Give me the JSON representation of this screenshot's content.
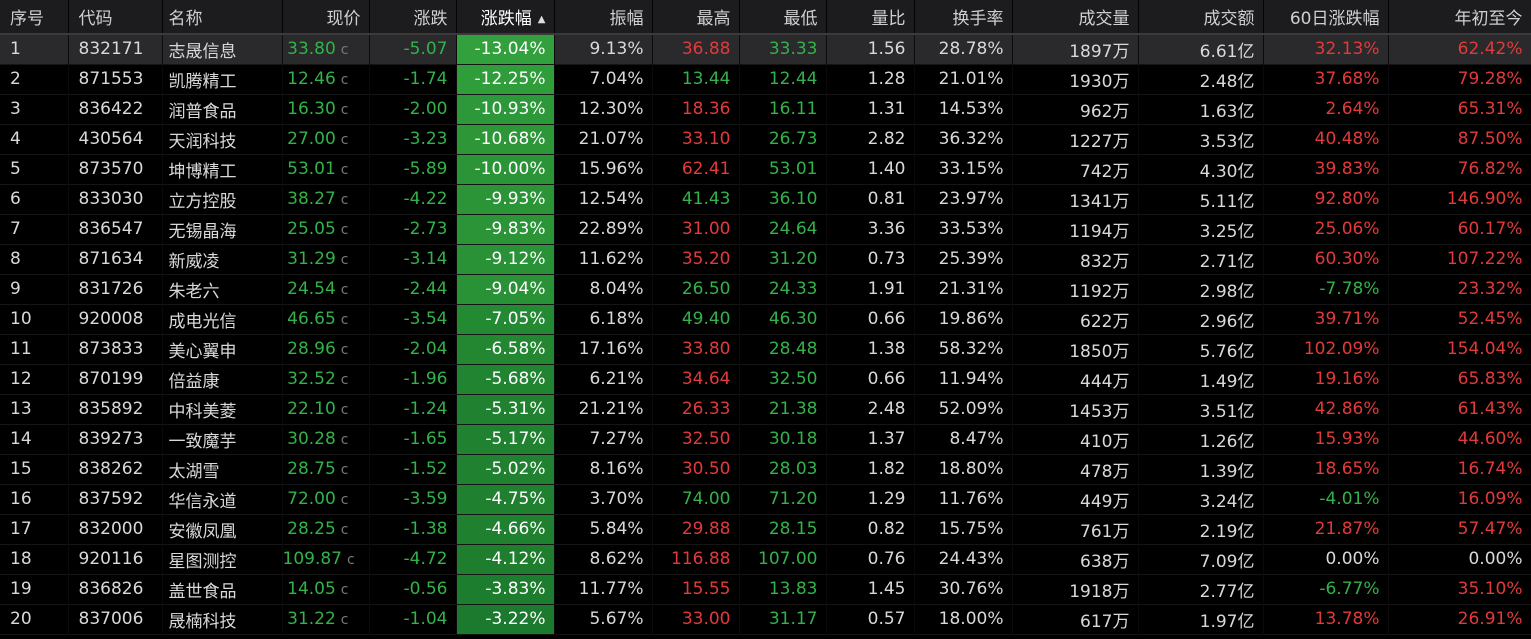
{
  "colors": {
    "up": "#e03a3a",
    "down": "#33b14a",
    "neutral": "#d9d9d9"
  },
  "columns": [
    "序号",
    "代码",
    "名称",
    "现价",
    "涨跌",
    "涨跌幅",
    "振幅",
    "最高",
    "最低",
    "量比",
    "换手率",
    "成交量",
    "成交额",
    "60日涨跌幅",
    "年初至今"
  ],
  "sort_arrow": "▲",
  "rows": [
    {
      "idx": "1",
      "code": "832171",
      "name": "志晟信息",
      "price": "33.80",
      "change": "-5.07",
      "pct": "-13.04%",
      "amp": "9.13%",
      "high": "36.88",
      "high_dir": "up",
      "low": "33.33",
      "low_dir": "down",
      "vr": "1.56",
      "turnover": "28.78%",
      "vol": "1897万",
      "amount": "6.61亿",
      "d60": "32.13%",
      "d60_dir": "up",
      "ytd": "62.42%",
      "ytd_dir": "up"
    },
    {
      "idx": "2",
      "code": "871553",
      "name": "凯腾精工",
      "price": "12.46",
      "change": "-1.74",
      "pct": "-12.25%",
      "amp": "7.04%",
      "high": "13.44",
      "high_dir": "down",
      "low": "12.44",
      "low_dir": "down",
      "vr": "1.28",
      "turnover": "21.01%",
      "vol": "1930万",
      "amount": "2.48亿",
      "d60": "37.68%",
      "d60_dir": "up",
      "ytd": "79.28%",
      "ytd_dir": "up"
    },
    {
      "idx": "3",
      "code": "836422",
      "name": "润普食品",
      "price": "16.30",
      "change": "-2.00",
      "pct": "-10.93%",
      "amp": "12.30%",
      "high": "18.36",
      "high_dir": "up",
      "low": "16.11",
      "low_dir": "down",
      "vr": "1.31",
      "turnover": "14.53%",
      "vol": "962万",
      "amount": "1.63亿",
      "d60": "2.64%",
      "d60_dir": "up",
      "ytd": "65.31%",
      "ytd_dir": "up"
    },
    {
      "idx": "4",
      "code": "430564",
      "name": "天润科技",
      "price": "27.00",
      "change": "-3.23",
      "pct": "-10.68%",
      "amp": "21.07%",
      "high": "33.10",
      "high_dir": "up",
      "low": "26.73",
      "low_dir": "down",
      "vr": "2.82",
      "turnover": "36.32%",
      "vol": "1227万",
      "amount": "3.53亿",
      "d60": "40.48%",
      "d60_dir": "up",
      "ytd": "87.50%",
      "ytd_dir": "up"
    },
    {
      "idx": "5",
      "code": "873570",
      "name": "坤博精工",
      "price": "53.01",
      "change": "-5.89",
      "pct": "-10.00%",
      "amp": "15.96%",
      "high": "62.41",
      "high_dir": "up",
      "low": "53.01",
      "low_dir": "down",
      "vr": "1.40",
      "turnover": "33.15%",
      "vol": "742万",
      "amount": "4.30亿",
      "d60": "39.83%",
      "d60_dir": "up",
      "ytd": "76.82%",
      "ytd_dir": "up"
    },
    {
      "idx": "6",
      "code": "833030",
      "name": "立方控股",
      "price": "38.27",
      "change": "-4.22",
      "pct": "-9.93%",
      "amp": "12.54%",
      "high": "41.43",
      "high_dir": "down",
      "low": "36.10",
      "low_dir": "down",
      "vr": "0.81",
      "turnover": "23.97%",
      "vol": "1341万",
      "amount": "5.11亿",
      "d60": "92.80%",
      "d60_dir": "up",
      "ytd": "146.90%",
      "ytd_dir": "up"
    },
    {
      "idx": "7",
      "code": "836547",
      "name": "无锡晶海",
      "price": "25.05",
      "change": "-2.73",
      "pct": "-9.83%",
      "amp": "22.89%",
      "high": "31.00",
      "high_dir": "up",
      "low": "24.64",
      "low_dir": "down",
      "vr": "3.36",
      "turnover": "33.53%",
      "vol": "1194万",
      "amount": "3.25亿",
      "d60": "25.06%",
      "d60_dir": "up",
      "ytd": "60.17%",
      "ytd_dir": "up"
    },
    {
      "idx": "8",
      "code": "871634",
      "name": "新威凌",
      "price": "31.29",
      "change": "-3.14",
      "pct": "-9.12%",
      "amp": "11.62%",
      "high": "35.20",
      "high_dir": "up",
      "low": "31.20",
      "low_dir": "down",
      "vr": "0.73",
      "turnover": "25.39%",
      "vol": "832万",
      "amount": "2.71亿",
      "d60": "60.30%",
      "d60_dir": "up",
      "ytd": "107.22%",
      "ytd_dir": "up"
    },
    {
      "idx": "9",
      "code": "831726",
      "name": "朱老六",
      "price": "24.54",
      "change": "-2.44",
      "pct": "-9.04%",
      "amp": "8.04%",
      "high": "26.50",
      "high_dir": "down",
      "low": "24.33",
      "low_dir": "down",
      "vr": "1.91",
      "turnover": "21.31%",
      "vol": "1192万",
      "amount": "2.98亿",
      "d60": "-7.78%",
      "d60_dir": "down",
      "ytd": "23.32%",
      "ytd_dir": "up"
    },
    {
      "idx": "10",
      "code": "920008",
      "name": "成电光信",
      "price": "46.65",
      "change": "-3.54",
      "pct": "-7.05%",
      "amp": "6.18%",
      "high": "49.40",
      "high_dir": "down",
      "low": "46.30",
      "low_dir": "down",
      "vr": "0.66",
      "turnover": "19.86%",
      "vol": "622万",
      "amount": "2.96亿",
      "d60": "39.71%",
      "d60_dir": "up",
      "ytd": "52.45%",
      "ytd_dir": "up"
    },
    {
      "idx": "11",
      "code": "873833",
      "name": "美心翼申",
      "price": "28.96",
      "change": "-2.04",
      "pct": "-6.58%",
      "amp": "17.16%",
      "high": "33.80",
      "high_dir": "up",
      "low": "28.48",
      "low_dir": "down",
      "vr": "1.38",
      "turnover": "58.32%",
      "vol": "1850万",
      "amount": "5.76亿",
      "d60": "102.09%",
      "d60_dir": "up",
      "ytd": "154.04%",
      "ytd_dir": "up"
    },
    {
      "idx": "12",
      "code": "870199",
      "name": "倍益康",
      "price": "32.52",
      "change": "-1.96",
      "pct": "-5.68%",
      "amp": "6.21%",
      "high": "34.64",
      "high_dir": "up",
      "low": "32.50",
      "low_dir": "down",
      "vr": "0.66",
      "turnover": "11.94%",
      "vol": "444万",
      "amount": "1.49亿",
      "d60": "19.16%",
      "d60_dir": "up",
      "ytd": "65.83%",
      "ytd_dir": "up"
    },
    {
      "idx": "13",
      "code": "835892",
      "name": "中科美菱",
      "price": "22.10",
      "change": "-1.24",
      "pct": "-5.31%",
      "amp": "21.21%",
      "high": "26.33",
      "high_dir": "up",
      "low": "21.38",
      "low_dir": "down",
      "vr": "2.48",
      "turnover": "52.09%",
      "vol": "1453万",
      "amount": "3.51亿",
      "d60": "42.86%",
      "d60_dir": "up",
      "ytd": "61.43%",
      "ytd_dir": "up"
    },
    {
      "idx": "14",
      "code": "839273",
      "name": "一致魔芋",
      "price": "30.28",
      "change": "-1.65",
      "pct": "-5.17%",
      "amp": "7.27%",
      "high": "32.50",
      "high_dir": "up",
      "low": "30.18",
      "low_dir": "down",
      "vr": "1.37",
      "turnover": "8.47%",
      "vol": "410万",
      "amount": "1.26亿",
      "d60": "15.93%",
      "d60_dir": "up",
      "ytd": "44.60%",
      "ytd_dir": "up"
    },
    {
      "idx": "15",
      "code": "838262",
      "name": "太湖雪",
      "price": "28.75",
      "change": "-1.52",
      "pct": "-5.02%",
      "amp": "8.16%",
      "high": "30.50",
      "high_dir": "up",
      "low": "28.03",
      "low_dir": "down",
      "vr": "1.82",
      "turnover": "18.80%",
      "vol": "478万",
      "amount": "1.39亿",
      "d60": "18.65%",
      "d60_dir": "up",
      "ytd": "16.74%",
      "ytd_dir": "up"
    },
    {
      "idx": "16",
      "code": "837592",
      "name": "华信永道",
      "price": "72.00",
      "change": "-3.59",
      "pct": "-4.75%",
      "amp": "3.70%",
      "high": "74.00",
      "high_dir": "down",
      "low": "71.20",
      "low_dir": "down",
      "vr": "1.29",
      "turnover": "11.76%",
      "vol": "449万",
      "amount": "3.24亿",
      "d60": "-4.01%",
      "d60_dir": "down",
      "ytd": "16.09%",
      "ytd_dir": "up"
    },
    {
      "idx": "17",
      "code": "832000",
      "name": "安徽凤凰",
      "price": "28.25",
      "change": "-1.38",
      "pct": "-4.66%",
      "amp": "5.84%",
      "high": "29.88",
      "high_dir": "up",
      "low": "28.15",
      "low_dir": "down",
      "vr": "0.82",
      "turnover": "15.75%",
      "vol": "761万",
      "amount": "2.19亿",
      "d60": "21.87%",
      "d60_dir": "up",
      "ytd": "57.47%",
      "ytd_dir": "up"
    },
    {
      "idx": "18",
      "code": "920116",
      "name": "星图测控",
      "price": "109.87",
      "change": "-4.72",
      "pct": "-4.12%",
      "amp": "8.62%",
      "high": "116.88",
      "high_dir": "up",
      "low": "107.00",
      "low_dir": "down",
      "vr": "0.76",
      "turnover": "24.43%",
      "vol": "638万",
      "amount": "7.09亿",
      "d60": "0.00%",
      "d60_dir": "neutral",
      "ytd": "0.00%",
      "ytd_dir": "neutral"
    },
    {
      "idx": "19",
      "code": "836826",
      "name": "盖世食品",
      "price": "14.05",
      "change": "-0.56",
      "pct": "-3.83%",
      "amp": "11.77%",
      "high": "15.55",
      "high_dir": "up",
      "low": "13.83",
      "low_dir": "down",
      "vr": "1.45",
      "turnover": "30.76%",
      "vol": "1918万",
      "amount": "2.77亿",
      "d60": "-6.77%",
      "d60_dir": "down",
      "ytd": "35.10%",
      "ytd_dir": "up"
    },
    {
      "idx": "20",
      "code": "837006",
      "name": "晟楠科技",
      "price": "31.22",
      "change": "-1.04",
      "pct": "-3.22%",
      "amp": "5.67%",
      "high": "33.00",
      "high_dir": "up",
      "low": "31.17",
      "low_dir": "down",
      "vr": "0.57",
      "turnover": "18.00%",
      "vol": "617万",
      "amount": "1.97亿",
      "d60": "13.78%",
      "d60_dir": "up",
      "ytd": "26.91%",
      "ytd_dir": "up"
    }
  ]
}
